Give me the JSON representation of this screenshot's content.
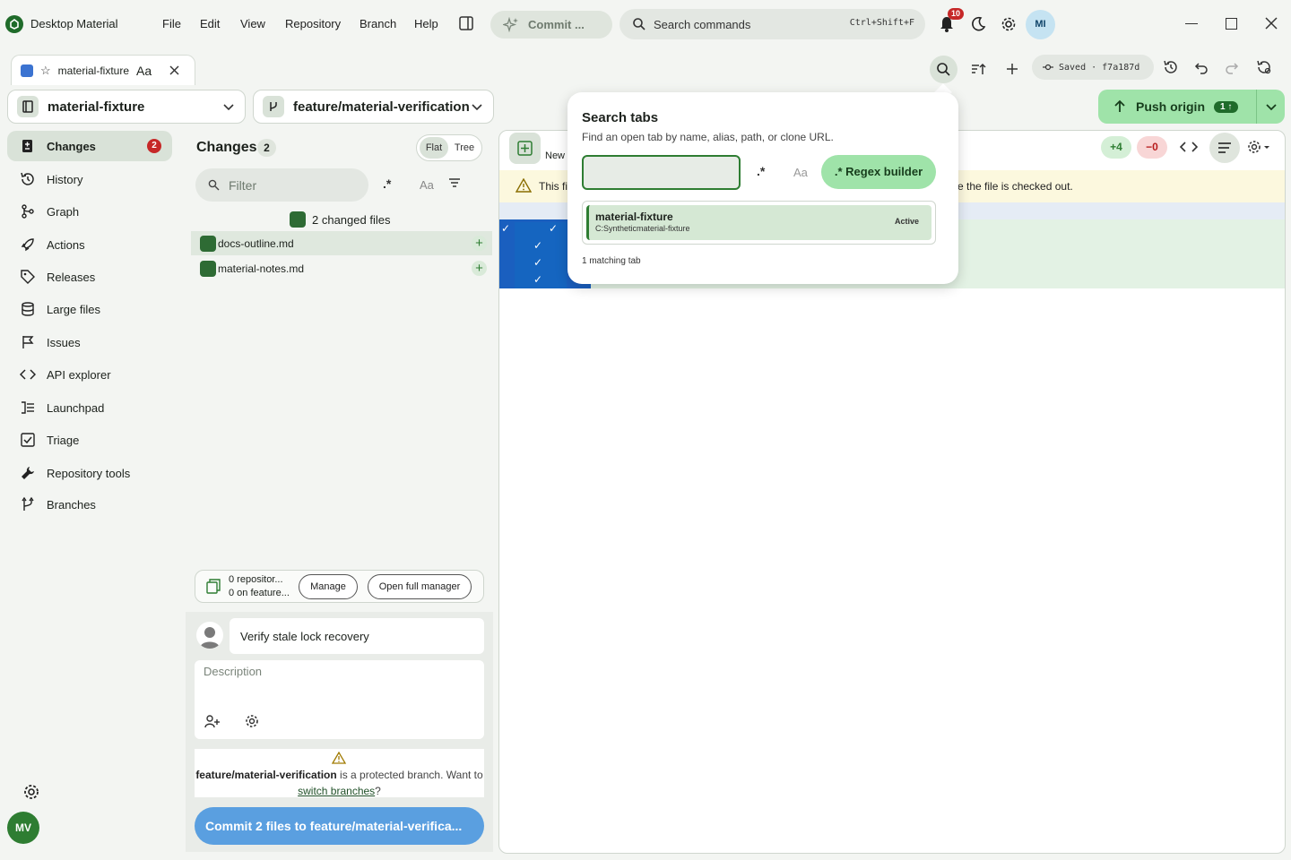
{
  "app": {
    "title": "Desktop Material"
  },
  "menu": [
    "File",
    "Edit",
    "View",
    "Repository",
    "Branch",
    "Help"
  ],
  "commit_pill": "Commit ...",
  "command_search": {
    "placeholder": "Search commands",
    "shortcut": "Ctrl+Shift+F"
  },
  "notifications": {
    "count": "10"
  },
  "user_avatar": "MI",
  "tab": {
    "label": "material-fixture",
    "case_glyph": "Aa"
  },
  "toolbar": {
    "saved_label": "Saved · f7a187d"
  },
  "repo_selector": "material-fixture",
  "branch_selector": "feature/material-verification",
  "push": {
    "label": "Push origin",
    "badge": "1 ↑"
  },
  "nav": [
    {
      "label": "Changes",
      "icon": "changes-icon",
      "badge": "2",
      "active": true
    },
    {
      "label": "History",
      "icon": "history-icon"
    },
    {
      "label": "Graph",
      "icon": "graph-icon"
    },
    {
      "label": "Actions",
      "icon": "rocket-icon"
    },
    {
      "label": "Releases",
      "icon": "tag-icon"
    },
    {
      "label": "Large files",
      "icon": "database-icon"
    },
    {
      "label": "Issues",
      "icon": "flag-icon"
    },
    {
      "label": "API explorer",
      "icon": "code-icon"
    },
    {
      "label": "Launchpad",
      "icon": "list-icon"
    },
    {
      "label": "Triage",
      "icon": "checkbox-icon"
    },
    {
      "label": "Repository tools",
      "icon": "wrench-icon"
    },
    {
      "label": "Branches",
      "icon": "branch-icon"
    }
  ],
  "bottom_avatar": "MV",
  "changes": {
    "title": "Changes",
    "count": "2",
    "view_flat": "Flat",
    "view_tree": "Tree",
    "filter_placeholder": "Filter",
    "regex_glyph": ".*",
    "case_glyph": "Aa",
    "summary": "2 changed files",
    "files": [
      "docs-outline.md",
      "material-notes.md"
    ]
  },
  "repo_manager": {
    "line1": "0 repositor...",
    "line2": "0 on feature...",
    "manage": "Manage",
    "open_full": "Open full manager"
  },
  "commit": {
    "summary": "Verify stale lock recovery",
    "description_placeholder": "Description",
    "protected_branch": "feature/material-verification",
    "protected_text": " is a protected branch. Want to ",
    "switch_link": "switch branches",
    "question": "?",
    "button": "Commit 2 files to feature/material-verifica..."
  },
  "diff": {
    "new_label": "New",
    "additions": "+4",
    "deletions": "−0",
    "warning_start": "This fil",
    "warning_end": "e the file is checked out."
  },
  "search_tabs": {
    "title": "Search tabs",
    "subtitle": "Find an open tab by name, alias, path, or clone URL.",
    "regex_glyph": ".*",
    "case_glyph": "Aa",
    "regex_builder": ".* Regex builder",
    "result_name": "material-fixture",
    "result_path": "C:Syntheticmaterial-fixture",
    "result_badge": "Active",
    "match_count": "1 matching tab"
  }
}
